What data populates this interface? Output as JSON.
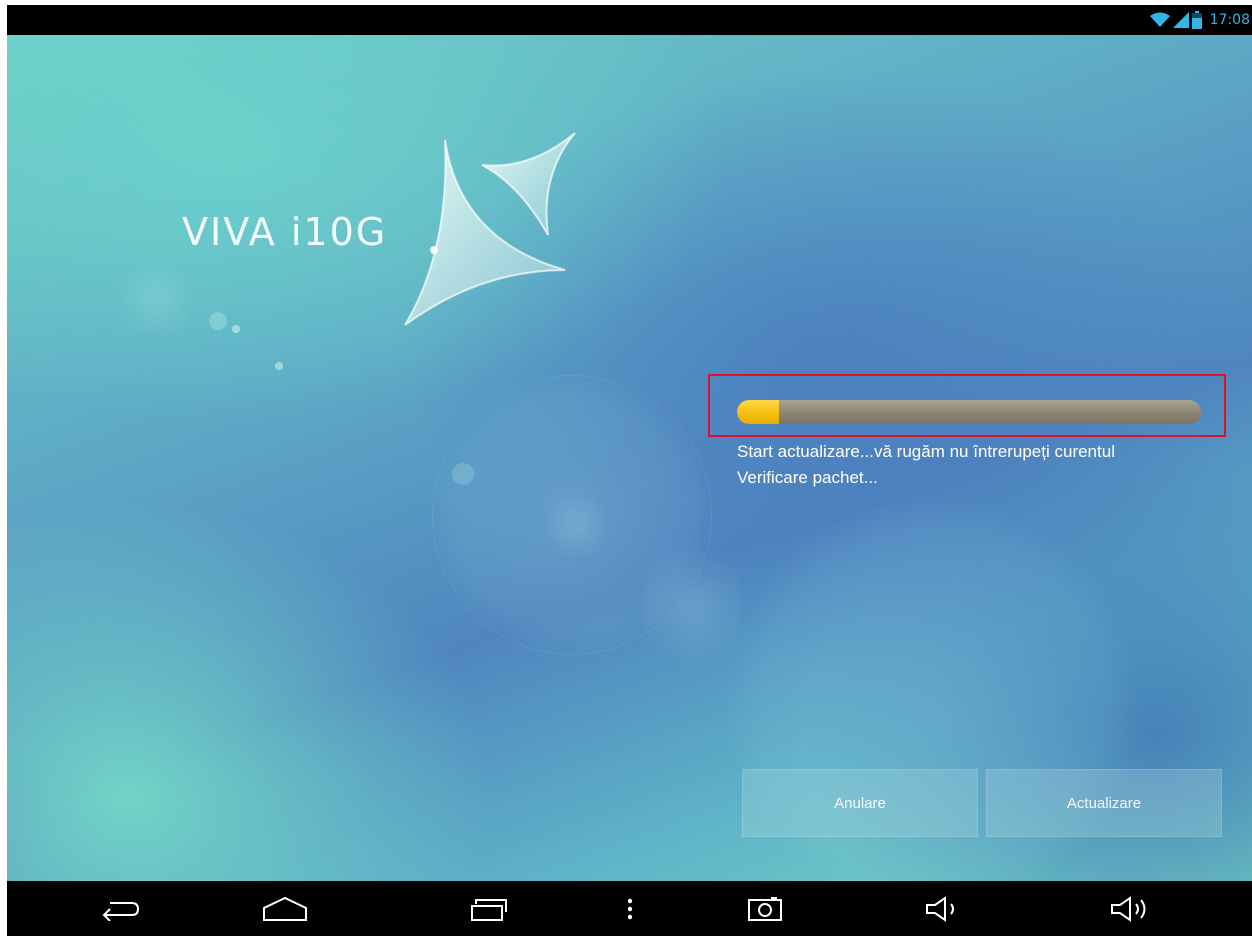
{
  "status_bar": {
    "time": "17:08",
    "icons": [
      "wifi-icon",
      "signal-icon",
      "battery-icon"
    ],
    "color": "#33b5e5"
  },
  "branding": {
    "logo_text": "VIVA i10G",
    "logo_icon": "star-logo-icon"
  },
  "update": {
    "progress": 0.09,
    "message_line1": "Start actualizare...vă rugăm nu întrerupeți curentul",
    "message_line2": "Verificare pachet...",
    "progress_color": "#f6bd0c",
    "highlight_color": "#e0102a"
  },
  "buttons": {
    "cancel_label": "Anulare",
    "update_label": "Actualizare"
  },
  "nav_bar": {
    "items": [
      "back-icon",
      "home-icon",
      "recent-apps-icon",
      "menu-icon",
      "screenshot-icon",
      "volume-down-icon",
      "volume-up-icon"
    ]
  }
}
